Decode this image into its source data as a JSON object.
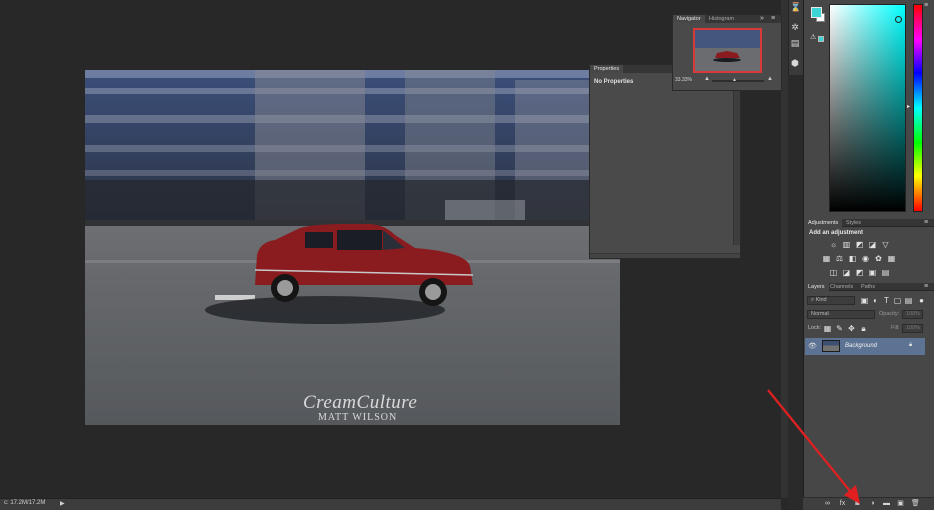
{
  "document": {
    "watermark_title": "CreamCulture",
    "watermark_subtitle": "MATT WILSON"
  },
  "status_bar": {
    "doc_size": "c: 17.2M/17.2M",
    "menu_arrow": "▶"
  },
  "navigator": {
    "tabs": [
      "Navigator",
      "Histogram"
    ],
    "zoom": "33.33%",
    "menu_icon": "hamburger-icon"
  },
  "properties": {
    "tab": "Properties",
    "message": "No Properties"
  },
  "color": {
    "foreground": "#3cd4d4",
    "background": "#ffffff"
  },
  "adjustments": {
    "tabs": [
      "Adjustments",
      "Styles"
    ],
    "heading": "Add an adjustment"
  },
  "layers": {
    "tabs": [
      "Layers",
      "Channels",
      "Paths"
    ],
    "filter_kind": "Kind",
    "blend_mode": "Normal",
    "opacity_label": "Opacity:",
    "opacity_value": "100%",
    "lock_label": "Lock:",
    "fill_label": "Fill:",
    "fill_value": "100%",
    "rows": [
      {
        "name": "Background",
        "visible": true,
        "locked": true
      }
    ]
  },
  "colors": {
    "accent_selection": "#5d7394",
    "annotation_arrow": "#e02020",
    "navigator_box": "#d83a3a"
  }
}
